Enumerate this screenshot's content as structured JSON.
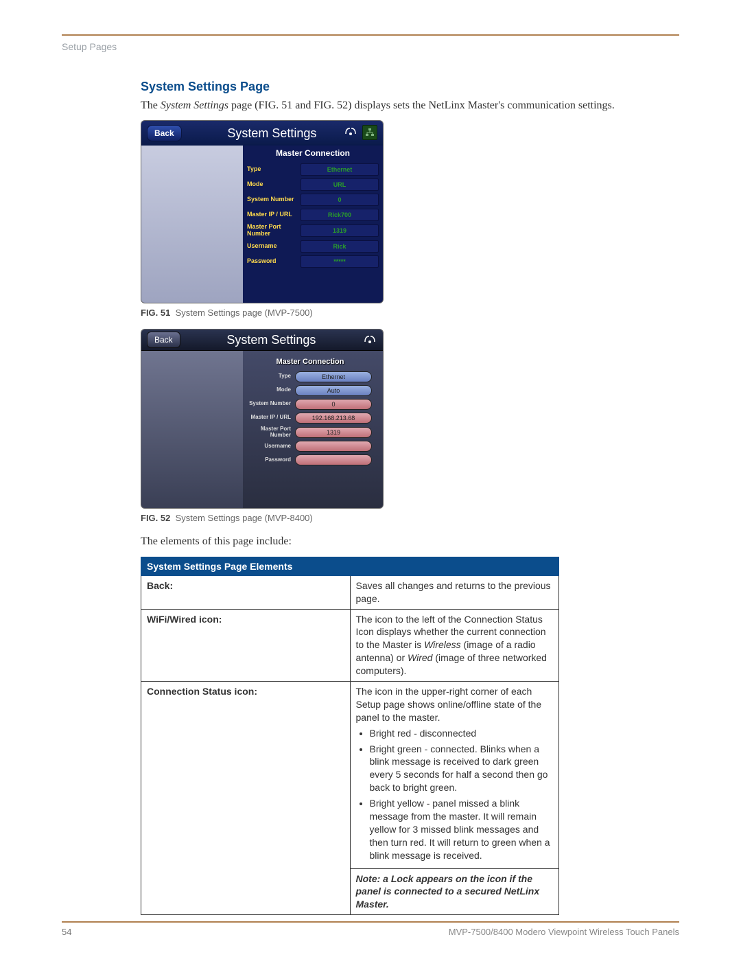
{
  "breadcrumb": "Setup Pages",
  "section_title": "System Settings Page",
  "intro_a": "The ",
  "intro_em": "System Settings",
  "intro_b": " page (FIG. 51 and FIG. 52) displays sets the NetLinx Master's communication settings.",
  "fig51": {
    "label": "FIG. 51",
    "caption": "System Settings page (MVP-7500)"
  },
  "fig52": {
    "label": "FIG. 52",
    "caption": "System Settings page (MVP-8400)"
  },
  "elements_intro": "The elements of this page include:",
  "panel_shared": {
    "back": "Back",
    "title": "System Settings",
    "mc_title": "Master Connection",
    "labels": {
      "type": "Type",
      "mode": "Mode",
      "sysnum": "System Number",
      "ipurl": "Master IP / URL",
      "port": "Master Port Number",
      "user": "Username",
      "pass": "Password"
    }
  },
  "panel75": {
    "type": "Ethernet",
    "mode": "URL",
    "sysnum": "0",
    "ipurl": "Rick700",
    "port": "1319",
    "user": "Rick",
    "pass": "*****"
  },
  "panel84": {
    "type": "Ethernet",
    "mode": "Auto",
    "sysnum": "0",
    "ipurl": "192.168.213.68",
    "port": "1319",
    "user": "",
    "pass": ""
  },
  "table": {
    "header": "System Settings Page Elements",
    "rows": {
      "back": {
        "label": "Back:",
        "text": "Saves all changes and returns to the previous page."
      },
      "wifi": {
        "label": "WiFi/Wired icon:",
        "t1": "The icon to the left of the Connection Status Icon displays whether the current connection to the Master is ",
        "em1": "Wireless",
        "t2": " (image of a radio antenna) or ",
        "em2": "Wired",
        "t3": " (image of three networked computers)."
      },
      "conn": {
        "label": "Connection Status icon:",
        "intro": "The icon in the upper-right corner of each Setup page shows online/offline state of the panel to the master.",
        "b1": "Bright red - disconnected",
        "b2": "Bright green - connected. Blinks when a blink message is received to dark green every 5 seconds for half a second then go back to bright green.",
        "b3": "Bright yellow - panel missed a blink message from the master. It will remain yellow for 3 missed blink messages and then turn red. It will return to green when a blink message is received.",
        "note_b": "Note",
        "note": ": a Lock appears on the icon if the panel is connected to a secured NetLinx Master."
      }
    }
  },
  "footer": {
    "page": "54",
    "doc": "MVP-7500/8400 Modero Viewpoint Wireless Touch Panels"
  }
}
